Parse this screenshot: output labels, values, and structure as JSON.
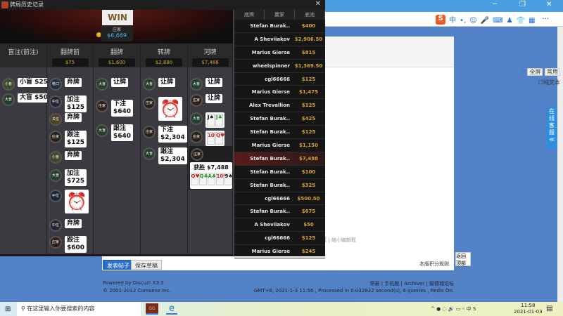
{
  "browser": {
    "ime_logo": "S",
    "ime_items": [
      "中",
      "•,",
      "☺",
      "🎤",
      "⌨",
      "♟",
      "👕",
      "▦"
    ],
    "more": "···",
    "min": "─",
    "max": "❐",
    "close": "✕"
  },
  "forum": {
    "fullscreen": "全屏",
    "common": "常用",
    "plaintext": "纯文本",
    "editor_tools": "原 | 恢复数据   字数检查 | 清除内容   加大编辑框 | 缩小编辑框",
    "post_button": "发表帖子",
    "save_draft": "保存草稿",
    "score_rules": "本版积分规则",
    "back_top": "返回顶部",
    "powered": "Powered by Discuz! X3.2",
    "copyright": "© 2001-2012 Comsenz Inc.",
    "links": "举报 | 手机版 | Archiver | 智德城论坛",
    "stats": "GMT+8, 2021-1-3 11:56 , Processed in 0.032822 second(s), 6 queries , Redis On.",
    "kefu": "在线客服",
    "kefu_collapse": "≪"
  },
  "poker": {
    "title": "牌局历史记录",
    "close": "✕",
    "win_label": "WIN",
    "dealer_label": "庄家",
    "dealer_stack": "$6,669",
    "columns": [
      {
        "name": "盲注(前注)",
        "pot": ""
      },
      {
        "name": "翻牌前",
        "pot": "$75"
      },
      {
        "name": "翻牌",
        "pot": "$1,600"
      },
      {
        "name": "转牌",
        "pot": "$2,880"
      },
      {
        "name": "河牌",
        "pot": "$7,488"
      }
    ],
    "actions": [
      [
        {
          "pos": "小盲",
          "text": "小盲 $25"
        },
        {
          "pos": "大盲",
          "text": "大盲 $50"
        }
      ],
      [
        {
          "pos": "枪口",
          "text": "弃牌"
        },
        {
          "pos": "中位",
          "text": "加注\n$125"
        },
        {
          "pos": "关位",
          "text": "弃牌"
        },
        {
          "pos": "庄家",
          "text": "跟注\n$125"
        },
        {
          "pos": "小盲",
          "text": "弃牌"
        },
        {
          "pos": "大盲",
          "text": "加注\n$725"
        },
        {
          "pos": "中位",
          "text": "",
          "timeout": true
        },
        {
          "pos": "中位",
          "text": "弃牌"
        },
        {
          "pos": "庄家",
          "text": "跟注\n$600"
        }
      ],
      [
        {
          "pos": "大盲",
          "text": "让牌"
        },
        {
          "pos": "庄家",
          "text": "下注\n$640"
        },
        {
          "pos": "大盲",
          "text": "跟注\n$640"
        }
      ],
      [
        {
          "pos": "大盲",
          "text": "让牌"
        },
        {
          "pos": "庄家",
          "text": "",
          "timeout": true
        },
        {
          "pos": "庄家",
          "text": "下注\n$2,304"
        },
        {
          "pos": "大盲",
          "text": "跟注\n$2,304"
        }
      ],
      [
        {
          "pos": "大盲",
          "text": "让牌"
        },
        {
          "pos": "庄家",
          "text": "让牌"
        },
        {
          "pos": "大盲",
          "cards": [
            "J♠",
            "J♣"
          ]
        },
        {
          "pos": "庄家",
          "cards": [
            "10♥",
            "Q♥"
          ]
        }
      ]
    ],
    "winner": {
      "pos": "庄家",
      "text": "获胜 $7,488",
      "cards": [
        "Q♥",
        "Q♣",
        "A♣",
        "10♥",
        "9♠"
      ]
    },
    "history_headers": [
      "底牌",
      "赢家",
      "底池"
    ],
    "history": [
      {
        "winner": "Stefan Burak..",
        "pot": "$400"
      },
      {
        "winner": "A Sheviiakov",
        "pot": "$2,906.50"
      },
      {
        "winner": "Marius Gierse",
        "pot": "$815"
      },
      {
        "winner": "wheelspinner",
        "pot": "$1,369.50"
      },
      {
        "winner": "cgl66666",
        "pot": "$125"
      },
      {
        "winner": "Marius Gierse",
        "pot": "$1,475"
      },
      {
        "winner": "Alex Trevallion",
        "pot": "$125"
      },
      {
        "winner": "Stefan Burak..",
        "pot": "$425"
      },
      {
        "winner": "Stefan Burak..",
        "pot": "$125"
      },
      {
        "winner": "Marius Gierse",
        "pot": "$1,150"
      },
      {
        "winner": "Stefan Burak..",
        "pot": "$7,488",
        "selected": true
      },
      {
        "winner": "Stefan Burak..",
        "pot": "$100"
      },
      {
        "winner": "Stefan Burak..",
        "pot": "$325"
      },
      {
        "winner": "cgl66666",
        "pot": "$500.50"
      },
      {
        "winner": "Stefan Burak..",
        "pot": "$675"
      },
      {
        "winner": "A Sheviiakov",
        "pot": "$50"
      },
      {
        "winner": "cgl66666",
        "pot": "$125"
      },
      {
        "winner": "Marius Gierse",
        "pot": "$245"
      }
    ]
  },
  "taskbar": {
    "search_placeholder": "在这里输入你要搜索的内容",
    "app1": "GG",
    "tray": "^ ● ◌ 🔊 ▭ 𝄐 中 S",
    "time": "11:58",
    "date": "2021-01-03"
  },
  "colors": {
    "accent_gold": "#d4a235",
    "page_blue": "#5281c5",
    "stack_cyan": "#3fb4e6"
  }
}
